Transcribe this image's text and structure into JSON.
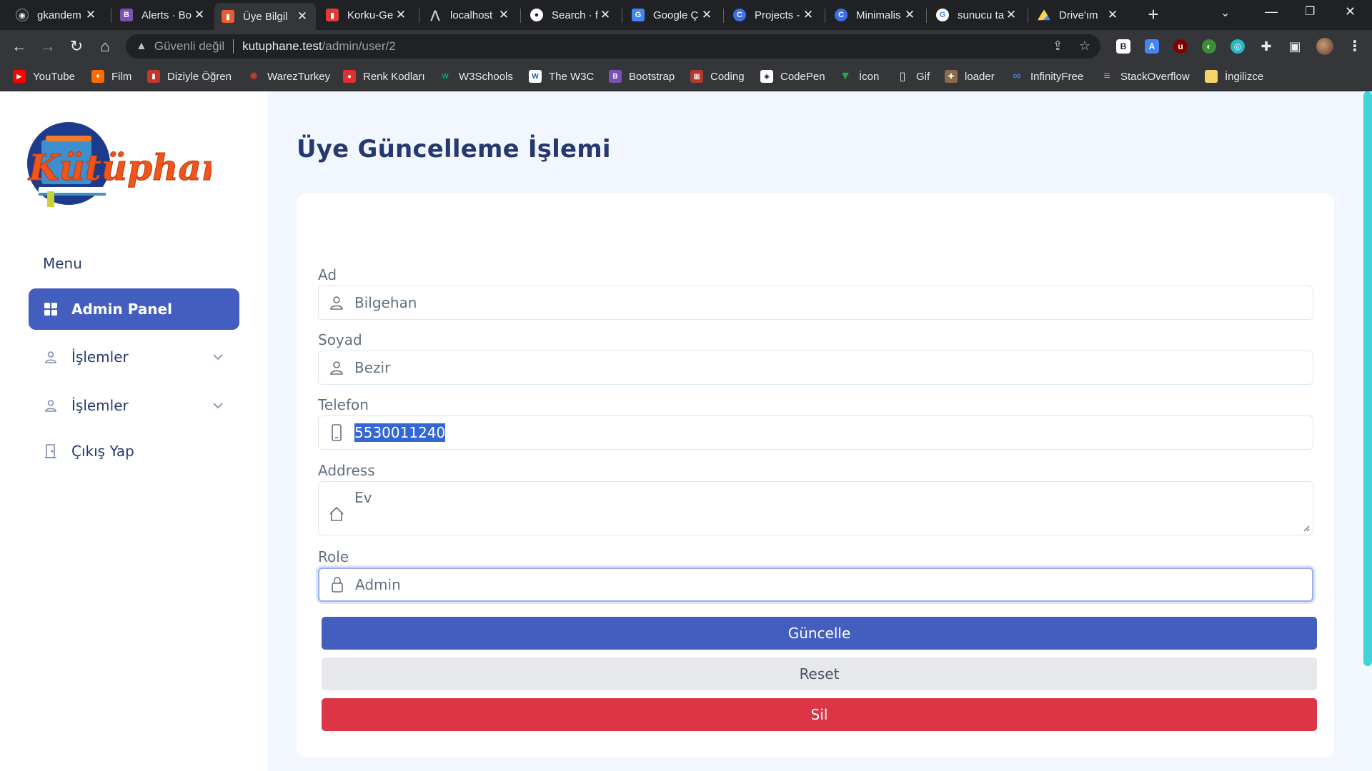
{
  "browser": {
    "tabs": [
      {
        "title": "gkandem",
        "icon": "github-icon",
        "color": "#24292e"
      },
      {
        "title": "Alerts · Bo",
        "icon": "bootstrap-icon",
        "color": "#7952b3"
      },
      {
        "title": "Üye Bilgil",
        "icon": "book-icon",
        "color": "#e85d2f"
      },
      {
        "title": "Korku-Ge",
        "icon": "book-icon",
        "color": "#e03a3a"
      },
      {
        "title": "localhost",
        "icon": "laragon-icon",
        "color": "#555"
      },
      {
        "title": "Search · f",
        "icon": "github-icon",
        "color": "#24292e"
      },
      {
        "title": "Google Ç",
        "icon": "translate-icon",
        "color": "#4285f4"
      },
      {
        "title": "Projects -",
        "icon": "canva-icon",
        "color": "#3b6ef0"
      },
      {
        "title": "Minimalis",
        "icon": "canva-icon",
        "color": "#3b6ef0"
      },
      {
        "title": "sunucu ta",
        "icon": "google-icon",
        "color": "#ffffff"
      },
      {
        "title": "Drive'ım",
        "icon": "drive-icon",
        "color": "#1fa463"
      }
    ],
    "url_warning": "Güvenli değil",
    "url_host": "kutuphane.test",
    "url_path": "/admin/user/2",
    "bookmarks": [
      {
        "label": "YouTube",
        "color": "#ff0000"
      },
      {
        "label": "Film",
        "color": "#ff6a00"
      },
      {
        "label": "Diziyle Öğren",
        "color": "#c0392b"
      },
      {
        "label": "WarezTurkey",
        "color": "#a33"
      },
      {
        "label": "Renk Kodları",
        "color": "#e0312f"
      },
      {
        "label": "W3Schools",
        "color": "#04aa6d"
      },
      {
        "label": "The W3C",
        "color": "#1a5ea8"
      },
      {
        "label": "Bootstrap",
        "color": "#7952b3"
      },
      {
        "label": "Coding",
        "color": "#b03a2e"
      },
      {
        "label": "CodePen",
        "color": "#111111"
      },
      {
        "label": "İcon",
        "color": "#20b04a"
      },
      {
        "label": "Gif",
        "color": "#4a4a4a"
      },
      {
        "label": "loader",
        "color": "#8a6a4a"
      },
      {
        "label": "InfinityFree",
        "color": "#3d7be0"
      },
      {
        "label": "StackOverflow",
        "color": "#f48024"
      },
      {
        "label": "İngilizce",
        "color": "#f6d36b"
      }
    ]
  },
  "sidebar": {
    "logo_text": "Kütüphane",
    "menu_title": "Menu",
    "items": [
      {
        "label": "Admin Panel",
        "icon": "grid-icon"
      },
      {
        "label": "İşlemler",
        "icon": "person-icon"
      },
      {
        "label": "İşlemler",
        "icon": "person-icon"
      },
      {
        "label": "Çıkış Yap",
        "icon": "door-icon"
      }
    ]
  },
  "main": {
    "title": "Üye Güncelleme İşlemi",
    "fields": {
      "ad": {
        "label": "Ad",
        "value": "Bilgehan"
      },
      "soyad": {
        "label": "Soyad",
        "value": "Bezir"
      },
      "telefon": {
        "label": "Telefon",
        "value": "5530011240"
      },
      "address": {
        "label": "Address",
        "value": "Ev"
      },
      "role": {
        "label": "Role",
        "value": "Admin"
      }
    },
    "buttons": {
      "update": "Güncelle",
      "reset": "Reset",
      "delete": "Sil"
    }
  },
  "colors": {
    "primary": "#435ebe",
    "danger": "#dc3545",
    "text_dark": "#25396f",
    "page_bg": "#f2f7ff"
  }
}
